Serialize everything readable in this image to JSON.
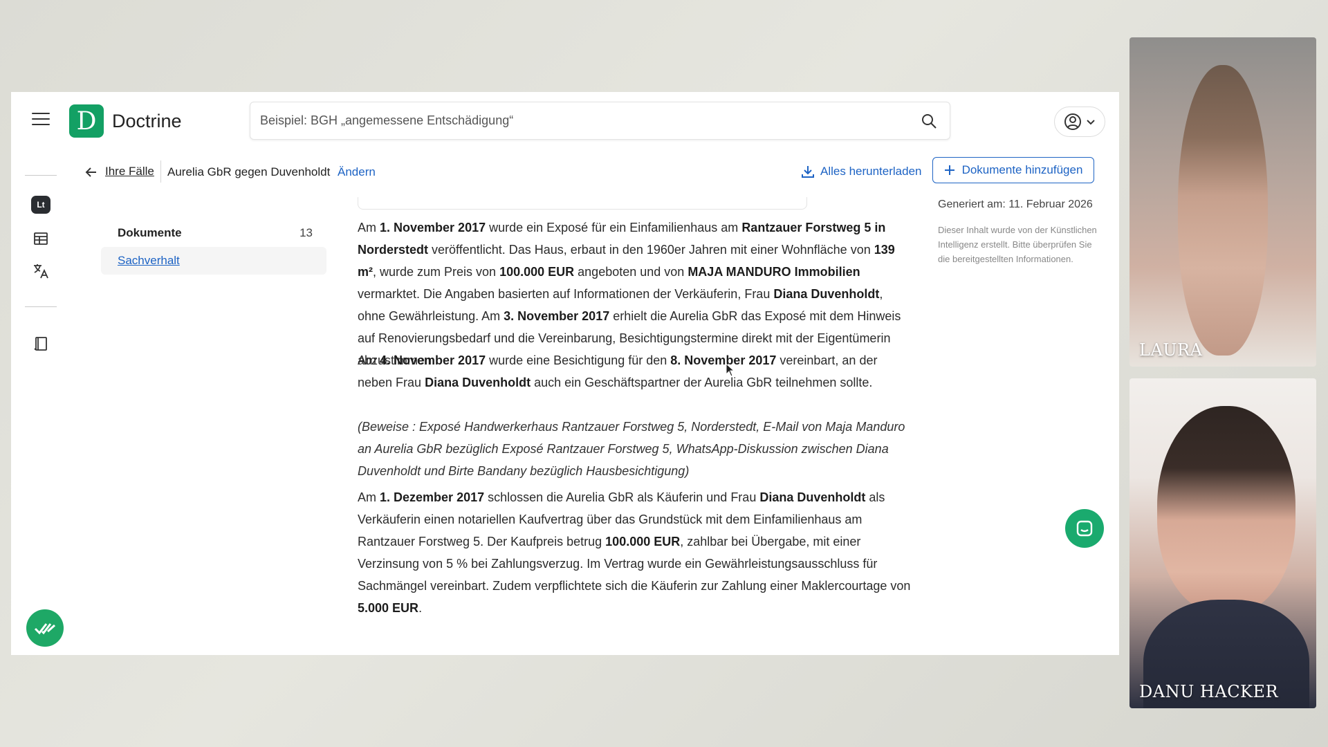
{
  "app": {
    "name": "Doctrine",
    "logo_letter": "D"
  },
  "search": {
    "placeholder": "Beispiel: BGH „angemessene Entschädigung“"
  },
  "breadcrumb": {
    "back_label": "Ihre Fälle",
    "case_title": "Aurelia GbR gegen Duvenholdt",
    "change_label": "Ändern"
  },
  "actions": {
    "download_all": "Alles herunterladen",
    "add_documents": "Dokumente hinzufügen"
  },
  "rail": {
    "badge": "Lt"
  },
  "doc_nav": {
    "items": [
      {
        "label": "Dokumente",
        "count": "13"
      },
      {
        "label": "Sachverhalt"
      }
    ]
  },
  "side_note": {
    "generated": "Generiert am: 11. Februar 2026",
    "ai_disclaimer": "Dieser Inhalt wurde von der Künstlichen Intelligenz erstellt. Bitte überprüfen Sie die bereitgestellten Informationen."
  },
  "content": {
    "p1": [
      {
        "t": "Am "
      },
      {
        "t": "1. November 2017",
        "b": true
      },
      {
        "t": " wurde ein Exposé für ein Einfamilienhaus am "
      },
      {
        "t": "Rantzauer Forstweg 5 in Norderstedt",
        "b": true
      },
      {
        "t": " veröffentlicht. Das Haus, erbaut in den 1960er Jahren mit einer Wohnfläche von "
      },
      {
        "t": "139 m²",
        "b": true
      },
      {
        "t": ", wurde zum Preis von "
      },
      {
        "t": "100.000 EUR",
        "b": true
      },
      {
        "t": " angeboten und von "
      },
      {
        "t": "MAJA MANDURO Immobilien",
        "b": true
      },
      {
        "t": " vermarktet. Die Angaben basierten auf Informationen der Verkäuferin, Frau "
      },
      {
        "t": "Diana Duvenholdt",
        "b": true
      },
      {
        "t": ", ohne Gewährleistung. Am "
      },
      {
        "t": "3. November 2017",
        "b": true
      },
      {
        "t": " erhielt die Aurelia GbR das Exposé mit dem Hinweis auf Renovierungsbedarf und die Vereinbarung, Besichtigungstermine direkt mit der Eigentümerin abzustimmen."
      }
    ],
    "p2": [
      {
        "t": "Am "
      },
      {
        "t": "4. November 2017",
        "b": true
      },
      {
        "t": " wurde eine Besichtigung für den "
      },
      {
        "t": "8. November 2017",
        "b": true
      },
      {
        "t": " vereinbart, an der neben Frau "
      },
      {
        "t": "Diana Duvenholdt",
        "b": true
      },
      {
        "t": " auch ein Geschäftspartner der Aurelia GbR teilnehmen sollte."
      }
    ],
    "evidence": "(Beweise : Exposé Handwerkerhaus Rantzauer Forstweg 5, Norderstedt, E-Mail von Maja Manduro an Aurelia GbR bezüglich Exposé Rantzauer Forstweg 5, WhatsApp-Diskussion zwischen Diana Duvenholdt und Birte Bandany bezüglich Hausbesichtigung)",
    "p3": [
      {
        "t": "Am "
      },
      {
        "t": "1. Dezember 2017",
        "b": true
      },
      {
        "t": " schlossen die Aurelia GbR als Käuferin und Frau "
      },
      {
        "t": "Diana Duvenholdt",
        "b": true
      },
      {
        "t": " als Verkäuferin einen notariellen Kaufvertrag über das Grundstück mit dem Einfamilienhaus am Rantzauer Forstweg 5. Der Kaufpreis betrug "
      },
      {
        "t": "100.000 EUR",
        "b": true
      },
      {
        "t": ", zahlbar bei Übergabe, mit einer Verzinsung von 5 % bei Zahlungsverzug. Im Vertrag wurde ein Gewährleistungsausschluss für Sachmängel vereinbart. Zudem verpflichtete sich die Käuferin zur Zahlung einer Maklercourtage von "
      },
      {
        "t": "5.000 EUR",
        "b": true
      },
      {
        "t": "."
      }
    ]
  },
  "participants": [
    {
      "name": "LAURA"
    },
    {
      "name": "DANU HACKER"
    }
  ],
  "colors": {
    "brand": "#13a064",
    "link": "#1d63c4",
    "fab": "#1aaa6e"
  },
  "icons": [
    "menu-icon",
    "search-icon",
    "account-icon",
    "chevron-down-icon",
    "arrow-left-icon",
    "download-icon",
    "plus-icon",
    "table-icon",
    "translate-icon",
    "book-icon",
    "check-double-icon",
    "chat-icon"
  ]
}
